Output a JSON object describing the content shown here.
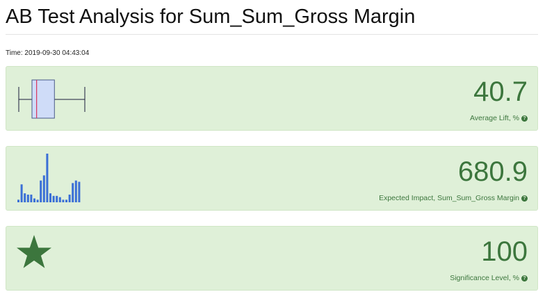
{
  "page": {
    "title": "AB Test Analysis for Sum_Sum_Gross Margin",
    "time": "Time: 2019-09-30 04:43:04"
  },
  "cards": [
    {
      "value": "40.7",
      "label": "Average Lift, %",
      "icon": "boxplot-icon"
    },
    {
      "value": "680.9",
      "label": "Expected Impact, Sum_Sum_Gross Margin",
      "icon": "histogram-icon"
    },
    {
      "value": "100",
      "label": "Significance Level, %",
      "icon": "star-icon"
    }
  ],
  "help_glyph": "?",
  "colors": {
    "card_bg": "#dff0d8",
    "accent": "#3c763d",
    "box_fill": "#cfdcf8",
    "box_median": "#d9345a",
    "hist_bar": "#3a6fd6",
    "star": "#3c763d"
  },
  "histogram": {
    "values": [
      2,
      14,
      7,
      6,
      6,
      3,
      2,
      17,
      21,
      38,
      7,
      5,
      5,
      4,
      2,
      2,
      6,
      15,
      17,
      16
    ]
  },
  "boxplot": {
    "whisker_low": 0,
    "q1": 0.2,
    "median": 0.27,
    "q3": 0.54,
    "whisker_high": 1
  }
}
